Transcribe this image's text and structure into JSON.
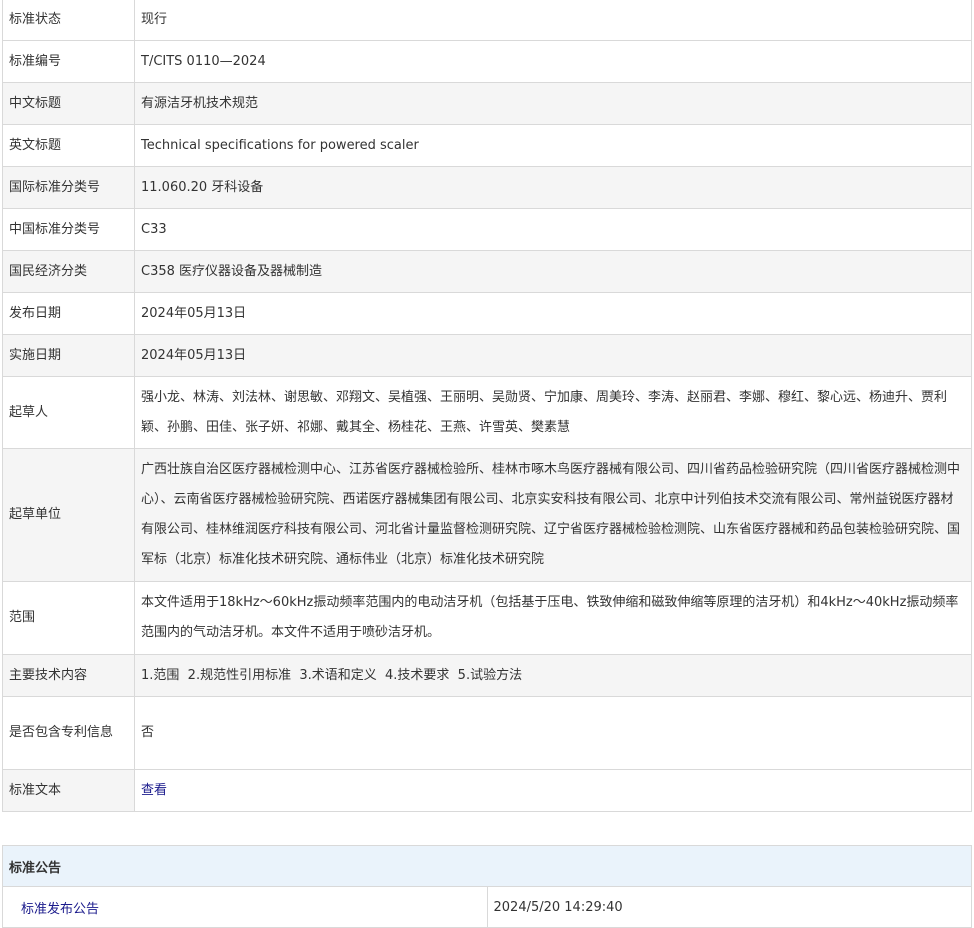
{
  "rows": [
    {
      "label": "标准状态",
      "value": "现行"
    },
    {
      "label": "标准编号",
      "value": "T/CITS 0110—2024"
    },
    {
      "label": "中文标题",
      "value": "有源洁牙机技术规范"
    },
    {
      "label": "英文标题",
      "value": "Technical specifications for powered scaler"
    },
    {
      "label": "国际标准分类号",
      "value": "11.060.20 牙科设备"
    },
    {
      "label": "中国标准分类号",
      "value": "C33"
    },
    {
      "label": "国民经济分类",
      "value": "C358 医疗仪器设备及器械制造"
    },
    {
      "label": "发布日期",
      "value": "2024年05月13日"
    },
    {
      "label": "实施日期",
      "value": "2024年05月13日"
    },
    {
      "label": "起草人",
      "value": "强小龙、林涛、刘法林、谢思敏、邓翔文、吴植强、王丽明、吴勋贤、宁加康、周美玲、李涛、赵丽君、李娜、穆红、黎心远、杨迪升、贾利颖、孙鹏、田佳、张子妍、祁娜、戴其全、杨桂花、王燕、许雪英、樊素慧"
    },
    {
      "label": "起草单位",
      "value": "广西壮族自治区医疗器械检测中心、江苏省医疗器械检验所、桂林市啄木鸟医疗器械有限公司、四川省药品检验研究院（四川省医疗器械检测中心）、云南省医疗器械检验研究院、西诺医疗器械集团有限公司、北京实安科技有限公司、北京中计列伯技术交流有限公司、常州益锐医疗器材有限公司、桂林维润医疗科技有限公司、河北省计量监督检测研究院、辽宁省医疗器械检验检测院、山东省医疗器械和药品包装检验研究院、国军标（北京）标准化技术研究院、通标伟业（北京）标准化技术研究院"
    },
    {
      "label": "范围",
      "value": "本文件适用于18kHz～60kHz振动频率范围内的电动洁牙机（包括基于压电、铁致伸缩和磁致伸缩等原理的洁牙机）和4kHz～40kHz振动频率范围内的气动洁牙机。本文件不适用于喷砂洁牙机。"
    },
    {
      "label": "主要技术内容",
      "value": "1.范围  2.规范性引用标准  3.术语和定义  4.技术要求  5.试验方法"
    },
    {
      "label": "是否包含专利信息",
      "value": "否"
    },
    {
      "label": "标准文本",
      "value": "查看"
    }
  ],
  "notice": {
    "header": "标准公告",
    "items": [
      {
        "title": "标准发布公告",
        "time": "2024/5/20 14:29:40"
      }
    ]
  },
  "colors": {
    "link": "#1a1a8c",
    "border": "#d9d9d9",
    "alt_row": "#f5f5f5",
    "notice_header_bg": "#eaf3fb"
  }
}
